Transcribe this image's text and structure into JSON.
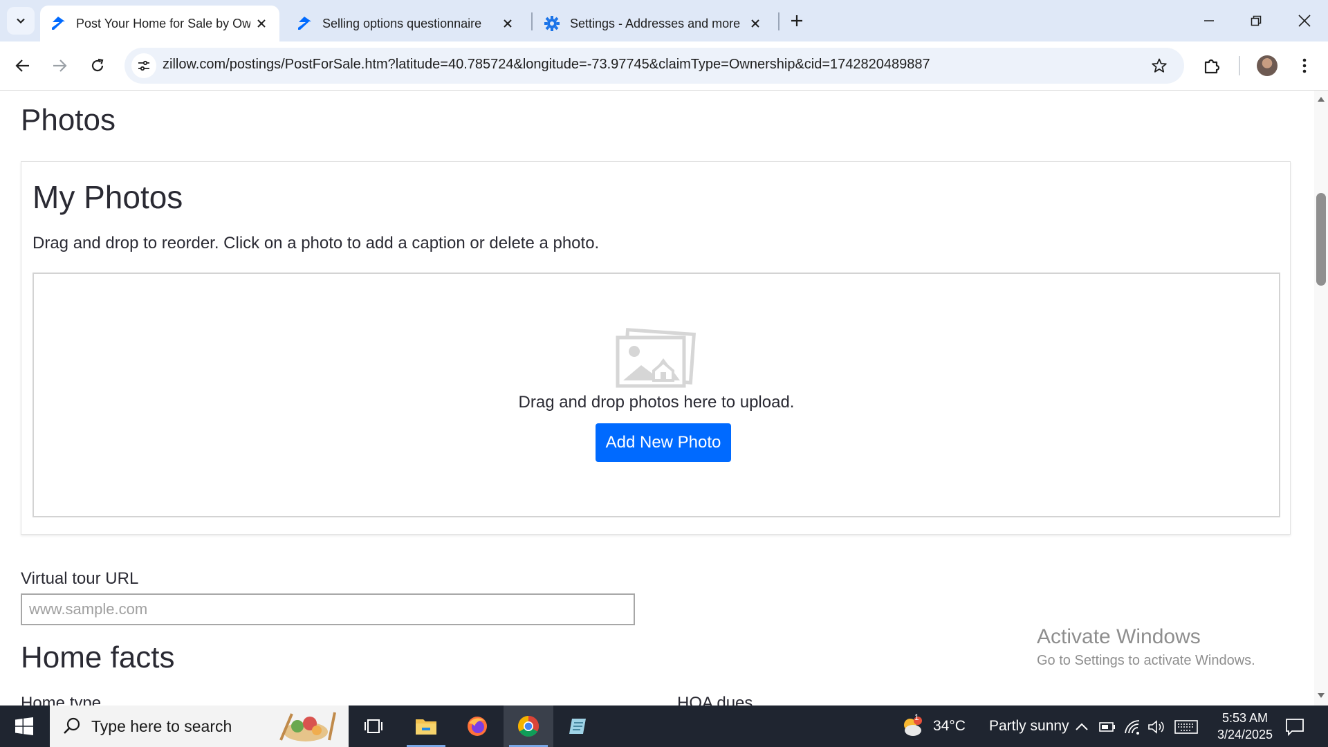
{
  "browser": {
    "tabs": [
      {
        "title": "Post Your Home for Sale by Ow",
        "favicon": "zillow-icon",
        "active": true
      },
      {
        "title": "Selling options questionnaire",
        "favicon": "zillow-icon",
        "active": false
      },
      {
        "title": "Settings - Addresses and more",
        "favicon": "gear-icon",
        "active": false
      }
    ],
    "url": "zillow.com/postings/PostForSale.htm?latitude=40.785724&longitude=-73.97745&claimType=Ownership&cid=1742820489887"
  },
  "page": {
    "photos_heading": "Photos",
    "my_photos": {
      "heading": "My Photos",
      "description": "Drag and drop to reorder. Click on a photo to add a caption or delete a photo.",
      "drop_text": "Drag and drop photos here to upload.",
      "add_button": "Add New Photo"
    },
    "virtual_tour": {
      "label": "Virtual tour URL",
      "placeholder": "www.sample.com",
      "value": ""
    },
    "home_facts": {
      "heading": "Home facts",
      "home_type_label": "Home type",
      "hoa_label": "HOA dues"
    },
    "watermark": {
      "line1": "Activate Windows",
      "line2": "Go to Settings to activate Windows."
    }
  },
  "taskbar": {
    "search_placeholder": "Type here to search",
    "weather": {
      "temp": "34°C",
      "condition": "Partly sunny",
      "badge": "1"
    },
    "time": "5:53 AM",
    "date": "3/24/2025"
  },
  "colors": {
    "accent_blue": "#006aff",
    "tab_strip": "#dfe8f7",
    "taskbar": "#1f2530"
  }
}
